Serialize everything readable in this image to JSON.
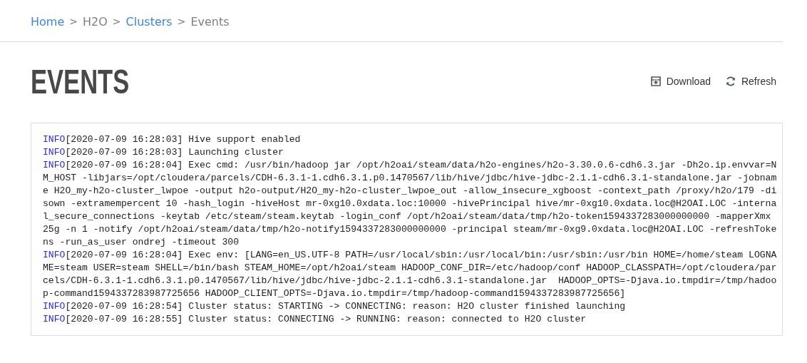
{
  "breadcrumb": [
    {
      "label": "Home",
      "link": true
    },
    {
      "label": "H2O",
      "link": false
    },
    {
      "label": "Clusters",
      "link": true
    },
    {
      "label": "Events",
      "link": false
    }
  ],
  "breadcrumb_separator": ">",
  "title": "EVENTS",
  "actions": [
    {
      "label": "Download",
      "kind": "download"
    },
    {
      "label": "Refresh",
      "kind": "refresh"
    }
  ],
  "log": [
    {
      "level": "INFO",
      "time": "[2020-07-09 16:28:03]",
      "message": "Hive support enabled"
    },
    {
      "level": "INFO",
      "time": "[2020-07-09 16:28:03]",
      "message": "Launching cluster"
    },
    {
      "level": "INFO",
      "time": "[2020-07-09 16:28:04]",
      "message": "Exec cmd: /usr/bin/hadoop jar /opt/h2oai/steam/data/h2o-engines/h2o-3.30.0.6-cdh6.3.jar -Dh2o.ip.envvar=NM_HOST -libjars=/opt/cloudera/parcels/CDH-6.3.1-1.cdh6.3.1.p0.1470567/lib/hive/jdbc/hive-jdbc-2.1.1-cdh6.3.1-standalone.jar -jobname H2O_my-h2o-cluster_lwpoe -output h2o-output/H2O_my-h2o-cluster_lwpoe_out -allow_insecure_xgboost -context_path /proxy/h2o/179 -disown -extramempercent 10 -hash_login -hiveHost mr-0xg10.0xdata.loc:10000 -hivePrincipal hive/mr-0xg10.0xdata.loc@H2OAI.LOC -internal_secure_connections -keytab /etc/steam/steam.keytab -login_conf /opt/h2oai/steam/data/tmp/h2o-token1594337283000000000 -mapperXmx 25g -n 1 -notify /opt/h2oai/steam/data/tmp/h2o-notify1594337283000000000 -principal steam/mr-0xg9.0xdata.loc@H2OAI.LOC -refreshTokens -run_as_user ondrej -timeout 300"
    },
    {
      "level": "INFO",
      "time": "[2020-07-09 16:28:04]",
      "message": "Exec env: [LANG=en_US.UTF-8 PATH=/usr/local/sbin:/usr/local/bin:/usr/sbin:/usr/bin HOME=/home/steam LOGNAME=steam USER=steam SHELL=/bin/bash STEAM_HOME=/opt/h2oai/steam HADOOP_CONF_DIR=/etc/hadoop/conf HADOOP_CLASSPATH=/opt/cloudera/parcels/CDH-6.3.1-1.cdh6.3.1.p0.1470567/lib/hive/jdbc/hive-jdbc-2.1.1-cdh6.3.1-standalone.jar  HADOOP_OPTS=-Djava.io.tmpdir=/tmp/hadoop-command1594337283987725656 HADOOP_CLIENT_OPTS=-Djava.io.tmpdir=/tmp/hadoop-command1594337283987725656]"
    },
    {
      "level": "INFO",
      "time": "[2020-07-09 16:28:54]",
      "message": "Cluster status: STARTING -> CONNECTING: reason: H2O cluster finished launching"
    },
    {
      "level": "INFO",
      "time": "[2020-07-09 16:28:55]",
      "message": "Cluster status: CONNECTING -> RUNNING: reason: connected to H2O cluster"
    }
  ]
}
